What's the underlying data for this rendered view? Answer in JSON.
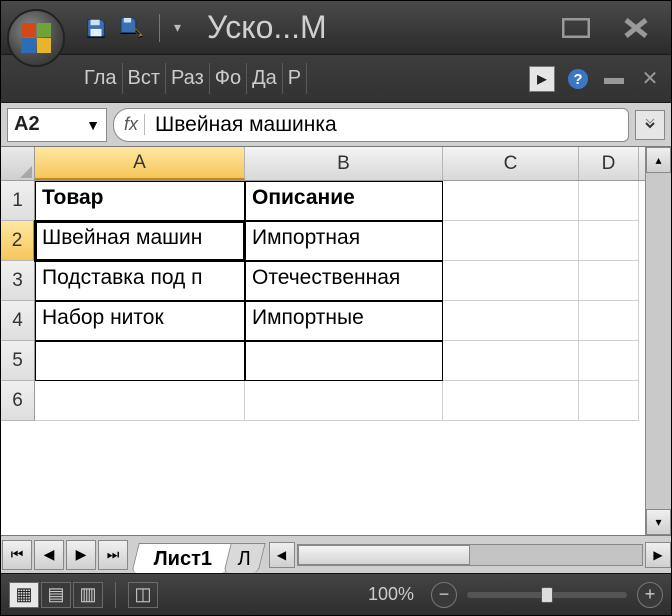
{
  "window": {
    "title": "Уско...М"
  },
  "ribbon": {
    "tabs": [
      "Гла",
      "Вст",
      "Раз",
      "Фо",
      "Да",
      "Р"
    ]
  },
  "formula": {
    "nameBox": "A2",
    "fxLabel": "fx",
    "value": "Швейная машинка"
  },
  "columns": [
    "A",
    "B",
    "C",
    "D"
  ],
  "rows": [
    "1",
    "2",
    "3",
    "4",
    "5",
    "6"
  ],
  "cells": {
    "A1": "Товар",
    "B1": "Описание",
    "A2": "Швейная машин",
    "B2": "Импортная",
    "A3": "Подставка под п",
    "B3": "Отечественная",
    "A4": "Набор ниток",
    "B4": "Импортные"
  },
  "activeCell": "A2",
  "sheets": {
    "active": "Лист1",
    "next": "Л"
  },
  "status": {
    "zoom": "100%"
  }
}
